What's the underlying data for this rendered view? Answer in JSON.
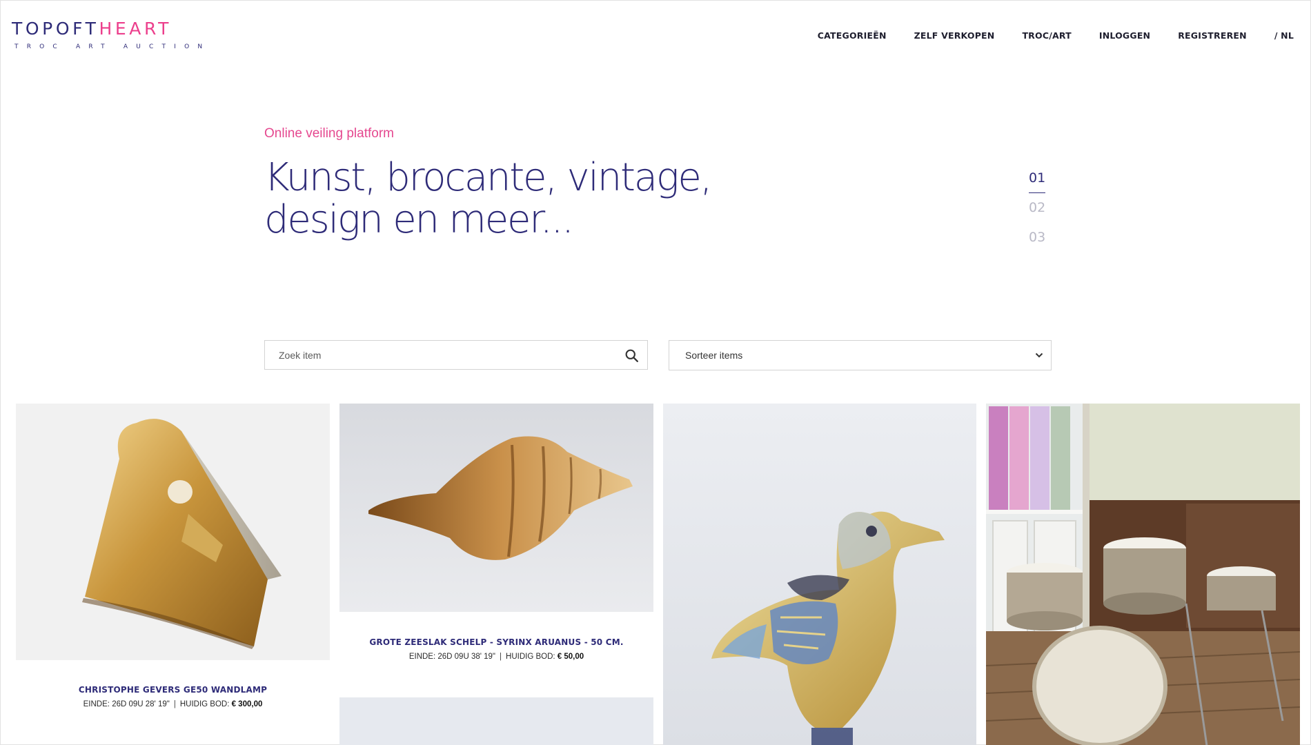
{
  "header": {
    "logo_part1": "TOPOFT",
    "logo_part2": "HEART",
    "logo_tagline": "TROC ART AUCTION",
    "nav": [
      {
        "label": "CATEGORIEËN"
      },
      {
        "label": "ZELF VERKOPEN"
      },
      {
        "label": "TROC/ART"
      },
      {
        "label": "INLOGGEN"
      },
      {
        "label": "REGISTREREN"
      },
      {
        "label": "/ NL"
      }
    ]
  },
  "hero": {
    "kicker": "Online veiling platform",
    "title_line1": "Kunst, brocante, vintage,",
    "title_line2": "design en meer...",
    "slides": [
      "01",
      "02",
      "03"
    ],
    "active_slide": "01"
  },
  "search": {
    "placeholder": "Zoek item",
    "sort_value": "Sorteer items"
  },
  "colors": {
    "brand_navy": "#2e2b78",
    "brand_pink": "#ec3f8c"
  },
  "items": [
    {
      "title": "CHRISTOPHE GEVERS GE50 WANDLAMP",
      "end_label": "EINDE:",
      "end_value": "26D 09U 28' 19\"",
      "bid_label": "HUIDIG BOD:",
      "bid_value": "€ 300,00"
    },
    {
      "title": "GROTE ZEESLAK SCHELP - SYRINX ARUANUS - 50 CM.",
      "end_label": "EINDE:",
      "end_value": "26D 09U 38' 19\"",
      "bid_label": "HUIDIG BOD:",
      "bid_value": "€ 50,00"
    }
  ]
}
